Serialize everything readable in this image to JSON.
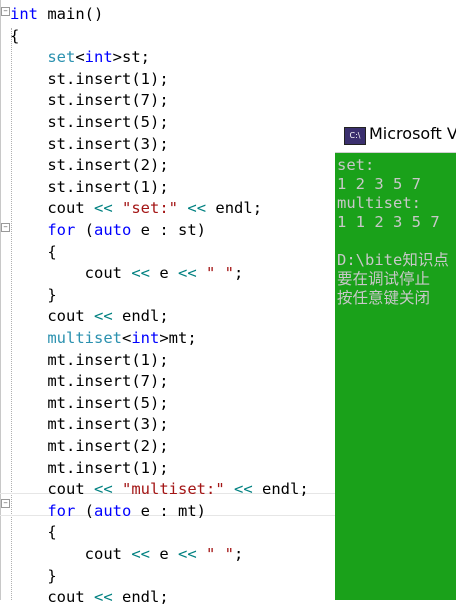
{
  "code_lines": [
    {
      "parts": [
        {
          "t": "int",
          "c": "kw"
        },
        {
          "t": " main()",
          "c": "fn"
        }
      ]
    },
    {
      "parts": [
        {
          "t": "{",
          "c": "fn"
        }
      ]
    },
    {
      "parts": [
        {
          "t": "    "
        },
        {
          "t": "set",
          "c": "ty"
        },
        {
          "t": "<",
          "c": "fn"
        },
        {
          "t": "int",
          "c": "kw"
        },
        {
          "t": ">",
          "c": "fn"
        },
        {
          "t": "st;",
          "c": "fn"
        }
      ]
    },
    {
      "parts": [
        {
          "t": "    "
        },
        {
          "t": "st",
          "c": "fn"
        },
        {
          "t": ".",
          "c": "fn"
        },
        {
          "t": "insert",
          "c": "fn"
        },
        {
          "t": "(1);",
          "c": "fn"
        }
      ]
    },
    {
      "parts": [
        {
          "t": "    "
        },
        {
          "t": "st",
          "c": "fn"
        },
        {
          "t": ".",
          "c": "fn"
        },
        {
          "t": "insert",
          "c": "fn"
        },
        {
          "t": "(7);",
          "c": "fn"
        }
      ]
    },
    {
      "parts": [
        {
          "t": "    "
        },
        {
          "t": "st",
          "c": "fn"
        },
        {
          "t": ".",
          "c": "fn"
        },
        {
          "t": "insert",
          "c": "fn"
        },
        {
          "t": "(5);",
          "c": "fn"
        }
      ]
    },
    {
      "parts": [
        {
          "t": "    "
        },
        {
          "t": "st",
          "c": "fn"
        },
        {
          "t": ".",
          "c": "fn"
        },
        {
          "t": "insert",
          "c": "fn"
        },
        {
          "t": "(3);",
          "c": "fn"
        }
      ]
    },
    {
      "parts": [
        {
          "t": "    "
        },
        {
          "t": "st",
          "c": "fn"
        },
        {
          "t": ".",
          "c": "fn"
        },
        {
          "t": "insert",
          "c": "fn"
        },
        {
          "t": "(2);",
          "c": "fn"
        }
      ]
    },
    {
      "parts": [
        {
          "t": "    "
        },
        {
          "t": "st",
          "c": "fn"
        },
        {
          "t": ".",
          "c": "fn"
        },
        {
          "t": "insert",
          "c": "fn"
        },
        {
          "t": "(1);",
          "c": "fn"
        }
      ]
    },
    {
      "parts": [
        {
          "t": "    "
        },
        {
          "t": "cout ",
          "c": "fn"
        },
        {
          "t": "<<",
          "c": "op"
        },
        {
          "t": " ",
          "c": "fn"
        },
        {
          "t": "\"set:\"",
          "c": "str"
        },
        {
          "t": " ",
          "c": "fn"
        },
        {
          "t": "<<",
          "c": "op"
        },
        {
          "t": " endl;",
          "c": "fn"
        }
      ]
    },
    {
      "parts": [
        {
          "t": "    "
        },
        {
          "t": "for",
          "c": "kw"
        },
        {
          "t": " (",
          "c": "fn"
        },
        {
          "t": "auto",
          "c": "kw"
        },
        {
          "t": " e : st)",
          "c": "fn"
        }
      ]
    },
    {
      "parts": [
        {
          "t": "    {",
          "c": "fn"
        }
      ]
    },
    {
      "parts": [
        {
          "t": "        cout ",
          "c": "fn"
        },
        {
          "t": "<<",
          "c": "op"
        },
        {
          "t": " e ",
          "c": "fn"
        },
        {
          "t": "<<",
          "c": "op"
        },
        {
          "t": " ",
          "c": "fn"
        },
        {
          "t": "\" \"",
          "c": "str"
        },
        {
          "t": ";",
          "c": "fn"
        }
      ]
    },
    {
      "parts": [
        {
          "t": "    }",
          "c": "fn"
        }
      ]
    },
    {
      "parts": [
        {
          "t": "    cout ",
          "c": "fn"
        },
        {
          "t": "<<",
          "c": "op"
        },
        {
          "t": " endl;",
          "c": "fn"
        }
      ]
    },
    {
      "parts": [
        {
          "t": "    "
        },
        {
          "t": "multiset",
          "c": "ty"
        },
        {
          "t": "<",
          "c": "fn"
        },
        {
          "t": "int",
          "c": "kw"
        },
        {
          "t": ">",
          "c": "fn"
        },
        {
          "t": "mt;",
          "c": "fn"
        }
      ]
    },
    {
      "parts": [
        {
          "t": "    mt.insert(1);",
          "c": "fn"
        }
      ]
    },
    {
      "parts": [
        {
          "t": "    mt.insert(7);",
          "c": "fn"
        }
      ]
    },
    {
      "parts": [
        {
          "t": "    mt.insert(5);",
          "c": "fn"
        }
      ]
    },
    {
      "parts": [
        {
          "t": "    mt.insert(3);",
          "c": "fn"
        }
      ]
    },
    {
      "parts": [
        {
          "t": "    mt.insert(2);",
          "c": "fn"
        }
      ]
    },
    {
      "parts": [
        {
          "t": "    mt.insert(1);",
          "c": "fn"
        }
      ]
    },
    {
      "parts": [
        {
          "t": "    cout ",
          "c": "fn"
        },
        {
          "t": "<<",
          "c": "op"
        },
        {
          "t": " ",
          "c": "fn"
        },
        {
          "t": "\"multiset:\"",
          "c": "str"
        },
        {
          "t": " ",
          "c": "fn"
        },
        {
          "t": "<<",
          "c": "op"
        },
        {
          "t": " endl;",
          "c": "fn"
        }
      ]
    },
    {
      "parts": [
        {
          "t": "    "
        },
        {
          "t": "for",
          "c": "kw"
        },
        {
          "t": " (",
          "c": "fn"
        },
        {
          "t": "auto",
          "c": "kw"
        },
        {
          "t": " e : mt)",
          "c": "fn"
        }
      ]
    },
    {
      "parts": [
        {
          "t": "    {",
          "c": "fn"
        }
      ]
    },
    {
      "parts": [
        {
          "t": "        cout ",
          "c": "fn"
        },
        {
          "t": "<<",
          "c": "op"
        },
        {
          "t": " e ",
          "c": "fn"
        },
        {
          "t": "<<",
          "c": "op"
        },
        {
          "t": " ",
          "c": "fn"
        },
        {
          "t": "\" \"",
          "c": "str"
        },
        {
          "t": ";",
          "c": "fn"
        }
      ]
    },
    {
      "parts": [
        {
          "t": "    }",
          "c": "fn"
        }
      ]
    },
    {
      "parts": [
        {
          "t": "    cout ",
          "c": "fn"
        },
        {
          "t": "<<",
          "c": "op"
        },
        {
          "t": " endl;",
          "c": "fn"
        }
      ]
    }
  ],
  "console": {
    "icon_text": "C:\\",
    "title": "Microsoft V",
    "lines": [
      "set:",
      "1 2 3 5 7",
      "multiset:",
      "1 1 2 3 5 7",
      "",
      "D:\\bite知识点",
      "要在调试停止",
      "按任意键关闭"
    ],
    "background": "#1aa11a"
  }
}
